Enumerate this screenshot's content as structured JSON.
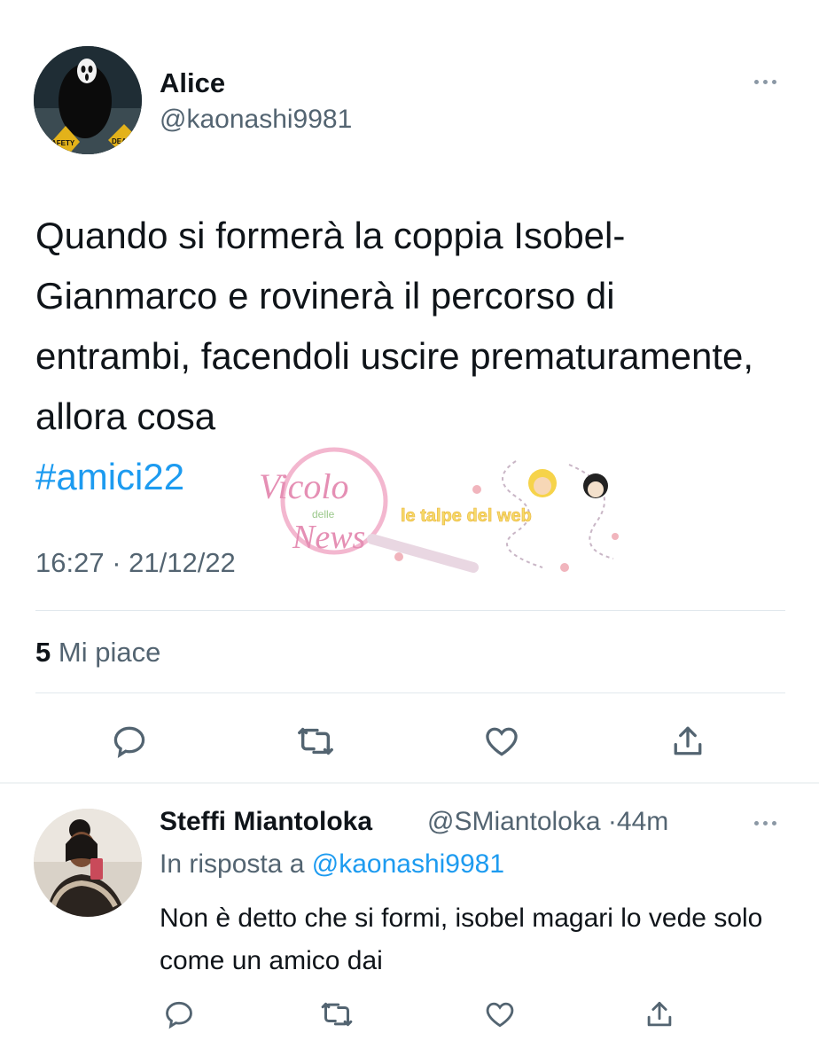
{
  "tweet": {
    "author_name": "Alice",
    "author_handle": "@kaonashi9981",
    "text": "Quando si formerà la coppia Isobel-Gianmarco e rovinerà il percorso di entrambi, facendoli uscire prematuramente, allora cosa",
    "hashtag": "#amici22",
    "timestamp": "16:27 · 21/12/22",
    "likes_count": "5",
    "likes_label": "Mi piace",
    "avatar_sign_left": "AFETY",
    "avatar_sign_right": "DEAT"
  },
  "reply": {
    "author_name": "Steffi Miantoloka",
    "author_handle": "@SMiantoloka",
    "time_sep": "·",
    "time": "44m",
    "in_reply_label": "In risposta a",
    "in_reply_mention": "@kaonashi9981",
    "text": "Non è detto che si formi, isobel magari lo vede solo come un amico dai"
  },
  "watermark": {
    "brand_line1": "Vicolo",
    "brand_small": "delle",
    "brand_line2": "News",
    "tagline": "le talpe del web"
  },
  "icons": {
    "more": "more-dots-icon",
    "reply": "reply-icon",
    "retweet": "retweet-icon",
    "like": "heart-icon",
    "share": "share-icon"
  },
  "colors": {
    "text": "#0f1419",
    "secondary": "#536471",
    "link": "#1d9bf0",
    "divider": "#e1e8ed"
  }
}
